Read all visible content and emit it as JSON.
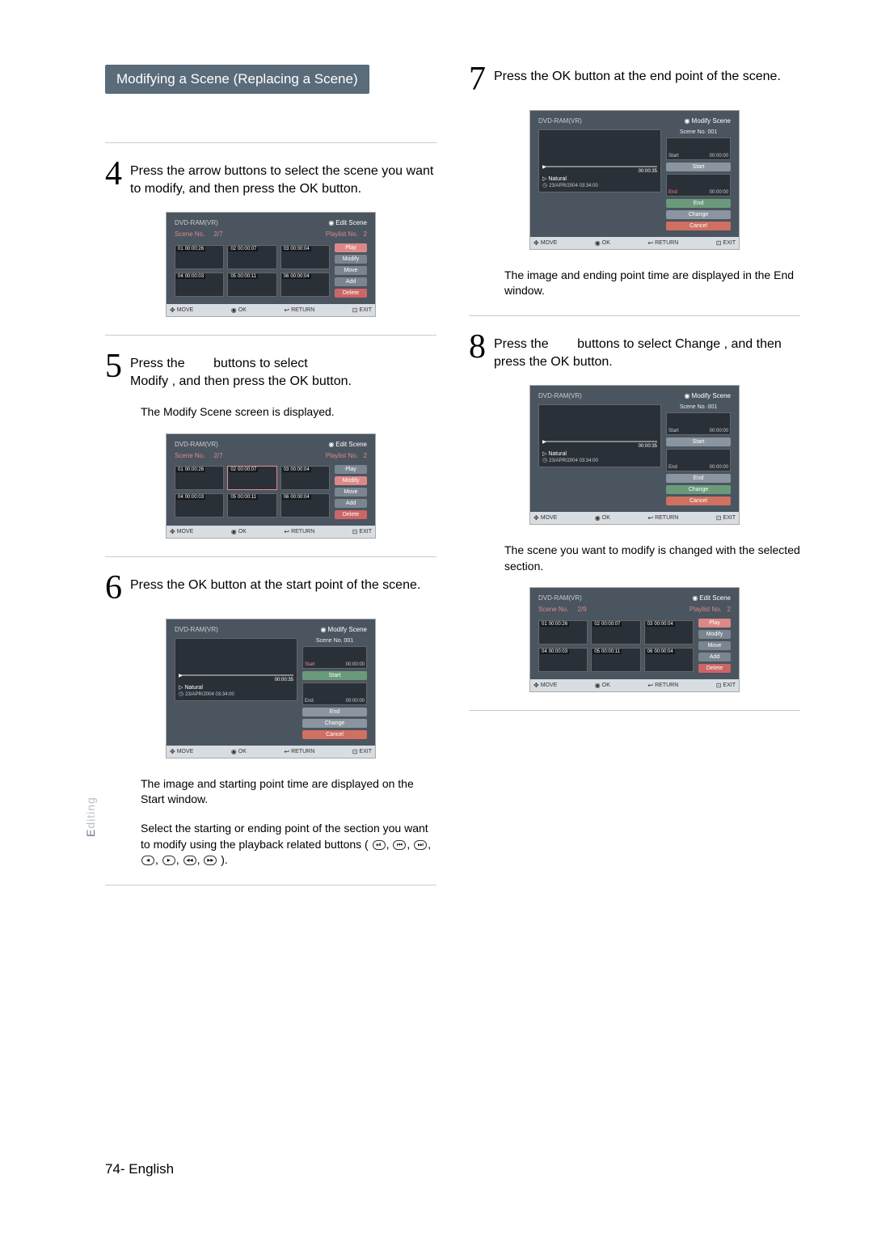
{
  "section_title": "Modifying a Scene (Replacing a Scene)",
  "side_tab": "Editing",
  "page_footer": "74- English",
  "steps": {
    "s4": {
      "num": "4",
      "text": "Press the arrow buttons to select the scene you want to modify, and then press the OK button."
    },
    "s5": {
      "num": "5",
      "text_a": "Press the",
      "text_b": "buttons to select",
      "text_c": "Modify , and then press the OK button.",
      "sub": "The Modify Scene screen is displayed."
    },
    "s6": {
      "num": "6",
      "text": "Press the OK button at the start point of the scene.",
      "sub_a": "The image and starting point time are displayed on the Start window.",
      "sub_b": "Select the starting or ending point of the section you want to modify using the playback related buttons (",
      "sub_c": ")."
    },
    "s7": {
      "num": "7",
      "text": "Press the OK button at the end point of the scene.",
      "sub": "The image and ending point time are displayed in the End window."
    },
    "s8": {
      "num": "8",
      "text_a": "Press the",
      "text_b": "buttons to select  Change , and then press the OK button.",
      "sub": "The scene you want to modify is changed with the selected section."
    }
  },
  "screen_common": {
    "header_left": "DVD-RAM(VR)",
    "edit_scene": "Edit Scene",
    "modify_scene": "Modify Scene",
    "scene_no": "Scene No.",
    "playlist_no": "Playlist No.",
    "move": "MOVE",
    "ok": "OK",
    "return": "RETURN",
    "exit": "EXIT"
  },
  "edit_buttons": {
    "play": "Play",
    "modify": "Modify",
    "move": "Move",
    "add": "Add",
    "delete": "Delete"
  },
  "modify_panel": {
    "scene_no_001": "Scene No. 001",
    "start": "Start",
    "end": "End",
    "change": "Change",
    "cancel": "Cancel",
    "natural": "Natural",
    "date": "23/APR/2004 03:34:00",
    "t_000035": "00:00:35",
    "t_000000": "00:00:00"
  },
  "edit_screen_27": {
    "count": "2/7",
    "pl": "2",
    "cells": [
      {
        "n": "01",
        "t": "00:00:26"
      },
      {
        "n": "02",
        "t": "00:00:07"
      },
      {
        "n": "03",
        "t": "00:00:04"
      },
      {
        "n": "04",
        "t": "00:00:03"
      },
      {
        "n": "05",
        "t": "00:00:11"
      },
      {
        "n": "06",
        "t": "00:00:04"
      }
    ]
  },
  "edit_screen_29": {
    "count": "2/9",
    "pl": "2",
    "cells": [
      {
        "n": "01",
        "t": "00:00:26"
      },
      {
        "n": "02",
        "t": "00:00:07"
      },
      {
        "n": "03",
        "t": "00:00:04"
      },
      {
        "n": "04",
        "t": "00:00:03"
      },
      {
        "n": "05",
        "t": "00:00:11"
      },
      {
        "n": "06",
        "t": "00:00:04"
      }
    ]
  }
}
